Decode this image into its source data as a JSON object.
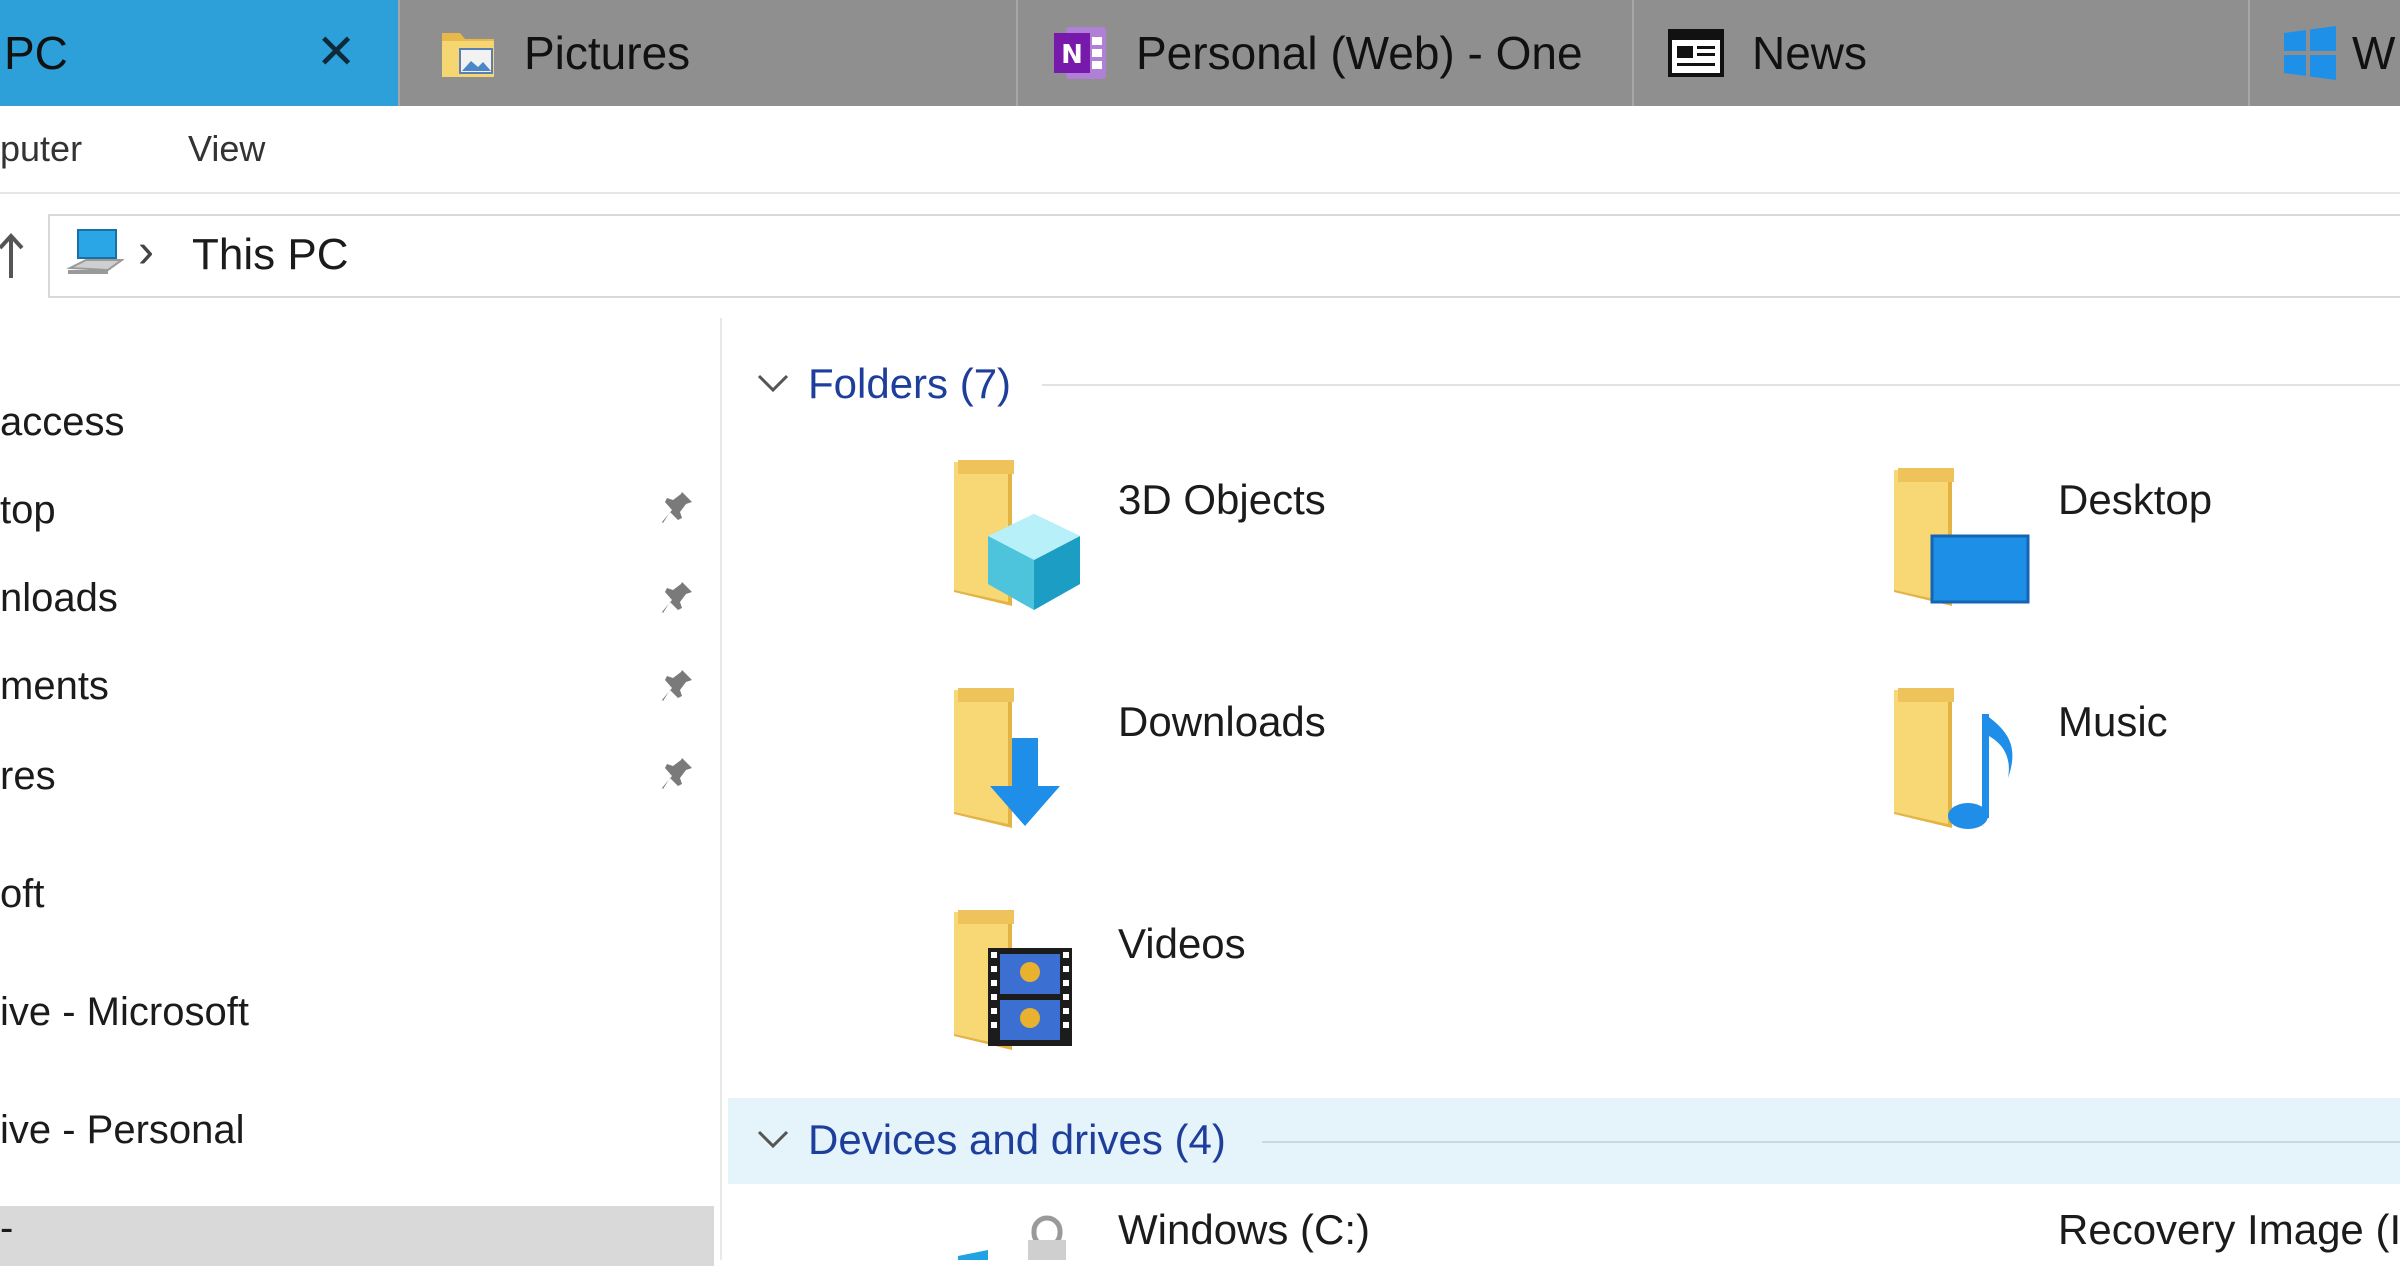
{
  "tabs": [
    {
      "label": "PC",
      "icon": "computer-icon",
      "active": true,
      "close": "✕"
    },
    {
      "label": "Pictures",
      "icon": "pictures-folder-icon"
    },
    {
      "label": "Personal (Web) - One",
      "icon": "onenote-icon"
    },
    {
      "label": "News",
      "icon": "news-icon"
    },
    {
      "label": "W",
      "icon": "windows-logo-icon"
    }
  ],
  "ribbon": {
    "tabs": [
      "puter",
      "View"
    ]
  },
  "address": {
    "breadcrumb_chevron": "›",
    "location": "This PC"
  },
  "nav": {
    "items": [
      {
        "label": "access",
        "pinned": false
      },
      {
        "label": "top",
        "pinned": true
      },
      {
        "label": "nloads",
        "pinned": true
      },
      {
        "label": "ments",
        "pinned": true
      },
      {
        "label": "res",
        "pinned": true
      },
      {
        "label": "oft",
        "pinned": false
      },
      {
        "label": "ive - Microsoft",
        "pinned": false
      },
      {
        "label": "ive - Personal",
        "pinned": false
      },
      {
        "label": "-",
        "pinned": false,
        "selected": true
      }
    ]
  },
  "content": {
    "folders_group": {
      "title": "Folders (7)"
    },
    "folders": [
      {
        "label": "3D Objects",
        "icon": "3d-objects-folder-icon"
      },
      {
        "label": "Desktop",
        "icon": "desktop-folder-icon"
      },
      {
        "label": "Downloads",
        "icon": "downloads-folder-icon"
      },
      {
        "label": "Music",
        "icon": "music-folder-icon"
      },
      {
        "label": "Videos",
        "icon": "videos-folder-icon"
      }
    ],
    "devices_group": {
      "title": "Devices and drives (4)"
    },
    "drives": [
      {
        "label": "Windows (C:)",
        "icon": "windows-drive-icon"
      },
      {
        "label": "Recovery Image (I",
        "icon": "recovery-drive-icon"
      }
    ]
  },
  "colors": {
    "accent_tab": "#2d9fd9",
    "group_title": "#1e3e9c",
    "tabbar": "#8f8f8f",
    "selection_band": "#e5f3fb"
  }
}
